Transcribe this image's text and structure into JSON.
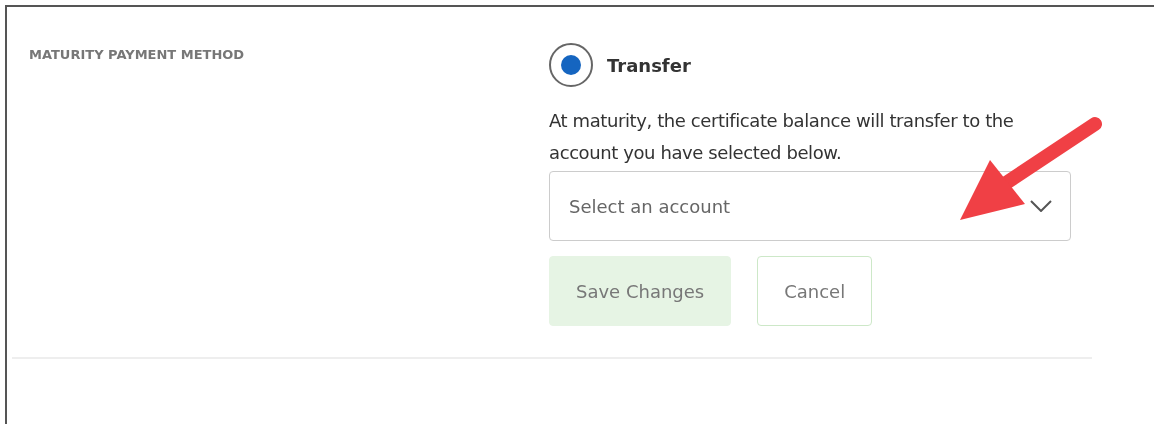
{
  "section_label": "MATURITY PAYMENT METHOD",
  "options": [
    {
      "label": "Transfer",
      "selected": true
    }
  ],
  "description": "At maturity, the certificate balance will transfer to the account you have selected below.",
  "account_select": {
    "placeholder": "Select an account"
  },
  "buttons": [
    {
      "label": "Save Changes",
      "kind": "primary"
    },
    {
      "label": "Cancel",
      "kind": "secondary"
    }
  ]
}
